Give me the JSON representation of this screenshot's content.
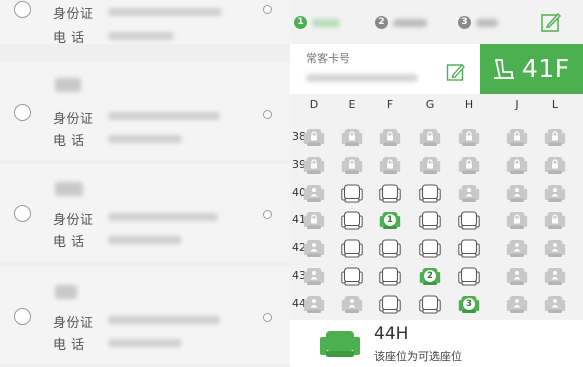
{
  "passengers": [
    {
      "id_label": "身份证",
      "phone_label": "电 话"
    },
    {
      "id_label": "身份证",
      "phone_label": "电 话"
    },
    {
      "id_label": "身份证",
      "phone_label": "电 话"
    },
    {
      "id_label": "身份证",
      "phone_label": "电 话"
    }
  ],
  "steps": [
    {
      "number": "1",
      "state": "active"
    },
    {
      "number": "2",
      "state": "pending"
    },
    {
      "number": "3",
      "state": "pending"
    }
  ],
  "frequent_card": {
    "label": "常客卡号"
  },
  "selected_seat": "41F",
  "colors": {
    "accent": "#4caf50",
    "accent_dark": "#2e7d32",
    "available": "#555555",
    "occupied": "#c8c8c8"
  },
  "seat_map": {
    "columns": [
      "D",
      "E",
      "F",
      "G",
      "H",
      "J",
      "L"
    ],
    "rows": [
      {
        "row": "38",
        "seats": [
          "locked",
          "locked",
          "locked",
          "locked",
          "locked",
          "locked",
          "locked"
        ]
      },
      {
        "row": "39",
        "seats": [
          "locked",
          "locked",
          "locked",
          "locked",
          "locked",
          "locked",
          "locked"
        ]
      },
      {
        "row": "40",
        "seats": [
          "person",
          "available",
          "available",
          "available",
          "person",
          "person",
          "person"
        ]
      },
      {
        "row": "41",
        "seats": [
          "locked",
          "available",
          "selected-1",
          "available",
          "available",
          "locked",
          "locked"
        ]
      },
      {
        "row": "42",
        "seats": [
          "person",
          "available",
          "available",
          "available",
          "available",
          "person",
          "person"
        ]
      },
      {
        "row": "43",
        "seats": [
          "person",
          "available",
          "available",
          "selected-2",
          "available",
          "person",
          "person"
        ]
      },
      {
        "row": "44",
        "seats": [
          "person",
          "person",
          "available",
          "available",
          "selected-3",
          "person",
          "person"
        ]
      }
    ]
  },
  "bottom": {
    "seat_code": "44H",
    "description": "该座位为可选座位",
    "icon": "seat-icon"
  }
}
